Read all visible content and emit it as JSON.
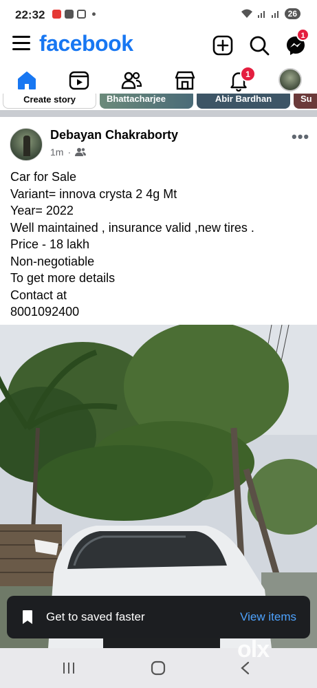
{
  "status_bar": {
    "time": "22:32",
    "battery": "26"
  },
  "header": {
    "logo": "facebook",
    "messenger_badge": "1",
    "icons": [
      "menu-icon",
      "plus-square-icon",
      "search-icon",
      "messenger-icon"
    ]
  },
  "nav": {
    "notifications_badge": "1",
    "tabs": [
      "home-icon",
      "video-icon",
      "friends-icon",
      "marketplace-icon",
      "bell-icon",
      "profile-avatar"
    ]
  },
  "stories": [
    {
      "label": "Create story"
    },
    {
      "label": "Bhattacharjee"
    },
    {
      "label": "Abir Bardhan"
    },
    {
      "label": "Su"
    }
  ],
  "post": {
    "author": "Debayan Chakraborty",
    "time": "1m",
    "audience_icon": "friends-icon",
    "lines": [
      "Car for Sale",
      "Variant= innova crysta 2 4g Mt",
      "Year= 2022",
      "Well maintained , insurance valid ,new tires .",
      "Price - 18 lakh",
      "Non-negotiable",
      "To get more details",
      "Contact at",
      "8001092400"
    ]
  },
  "toast": {
    "text": "Get to saved faster",
    "action": "View items"
  },
  "watermark": "olx",
  "colors": {
    "brand": "#1877f2",
    "badge": "#e41e3f",
    "toast_bg": "#1c1e21",
    "toast_action": "#4ea3ff"
  }
}
